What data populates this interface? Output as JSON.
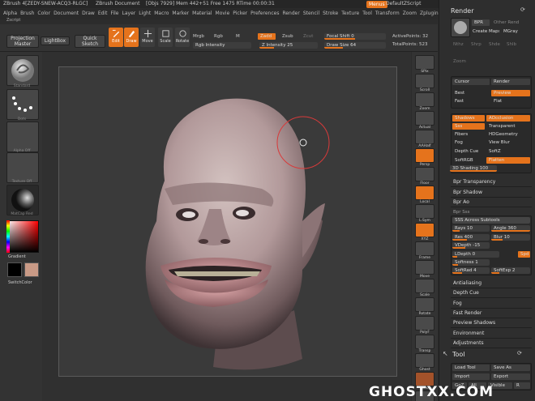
{
  "titlebar": {
    "app": "ZBrush 4[ZEDY-SNEW-ACQ3-RLGC]",
    "document": "ZBrush Document",
    "stats": "[Objs 7929]  Mem 442+51  Free 1475  RTime 00:00:31",
    "badge_menus": "Menus",
    "script": "DefaultZScript"
  },
  "menubar": {
    "items": [
      "Alpha",
      "Brush",
      "Color",
      "Document",
      "Draw",
      "Edit",
      "File",
      "Layer",
      "Light",
      "Macro",
      "Marker",
      "Material",
      "Movie",
      "Picker",
      "Preferences",
      "Render",
      "Stencil",
      "Stroke",
      "Texture",
      "Tool",
      "Transform",
      "Zoom",
      "Zplugin"
    ],
    "sub": "Zscript"
  },
  "shelf": {
    "projection_master": "Projection Master",
    "lightbox": "LightBox",
    "quick_sketch": "Quick Sketch",
    "tools": [
      "Edit",
      "Draw",
      "Move",
      "Scale",
      "Rotate"
    ],
    "mrgb": "Mrgb",
    "rgb": "Rgb",
    "m": "M",
    "zadd": "Zadd",
    "zsub": "Zsub",
    "zcut": "Zcut",
    "rgb_intensity": "Rgb Intensity",
    "z_intensity": "Z Intensity 25",
    "focal_shift": "Focal Shift 0",
    "draw_size": "Draw Size 64",
    "active_points": "ActivePoints: 32",
    "total_points": "TotalPoints: 523"
  },
  "lefttray": {
    "brush": "Standard",
    "stroke": "Dots",
    "alpha": "Alpha Off",
    "texture": "Texture Off",
    "material": "MatCap Red",
    "gradient": "Gradient",
    "switch_color": "SwitchColor"
  },
  "rightshelf": {
    "items": [
      "SPix",
      "Scroll",
      "Zoom",
      "Actual",
      "AAHalf",
      "Persp",
      "Floor",
      "Local",
      "L.Sym",
      "XYZ",
      "Frame",
      "Move",
      "Scale",
      "Rotate",
      "PolyF",
      "Transp",
      "Ghost",
      "Solo",
      "Dynamic"
    ]
  },
  "render": {
    "title": "Render",
    "bpr": "BPR",
    "other_renders": "Other Renders",
    "create_maps": "Create Maps",
    "mgray": "MGray",
    "row2": [
      "Nthz",
      "Shrp",
      "Shde",
      "Shlb"
    ],
    "zoom": "Zoom",
    "cursor": "Cursor",
    "render_btn": "Render",
    "best": "Best",
    "preview": "Preview",
    "fast": "Fast",
    "flat": "Flat",
    "shadows": "Shadows",
    "aocclusion": "AOcclusion",
    "sss": "Sss",
    "transparent": "Transparent",
    "fibers": "Fibers",
    "hdgeometry": "HDGeometry",
    "fog": "Fog",
    "view_blur": "View Blur",
    "depth_cue": "Depth Cue",
    "softz": "SoftZ",
    "soft_rgb": "SoftRGB",
    "flatten": "Flatten",
    "shading": "3D Shading 100",
    "bpr_transparency": "Bpr Transparency",
    "bpr_shadow": "Bpr Shadow",
    "bpr_ao": "Bpr Ao",
    "bpr_sss": "Bpr Sss",
    "sss_across": "SSS Across Subtools",
    "rays": "Rays 10",
    "angle": "Angle 360",
    "res": "Res 400",
    "blur": "Blur 10",
    "vdepth": "VDepth -15",
    "ldepth": "LDepth 0",
    "spd": "Spd",
    "softness": "Softness 1",
    "softrad": "SoftRad 4",
    "softexp": "SoftExp 2",
    "sections": [
      "Antialiasing",
      "Depth Cue",
      "Fog",
      "Fast Render",
      "Preview Shadows",
      "Environment",
      "Adjustments"
    ],
    "tool_title": "Tool",
    "load_tool": "Load Tool",
    "save_as": "Save As",
    "import": "Import",
    "export": "Export",
    "goz": "GoZ",
    "all": "All",
    "visible": "Visible",
    "r": "R"
  },
  "watermark": "GHOSTXX.COM"
}
